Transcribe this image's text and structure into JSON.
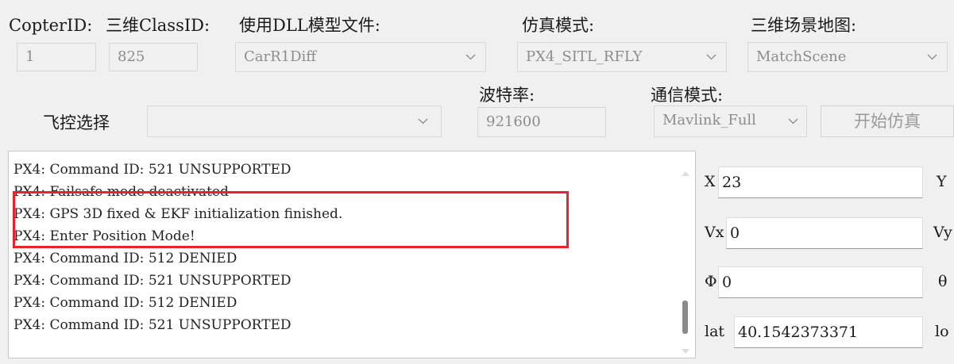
{
  "header": {
    "copter_id_label": "CopterID:",
    "class_id_label": "三维ClassID:",
    "dll_label": "使用DLL模型文件:",
    "sim_mode_label": "仿真模式:",
    "scene_label": "三维场景地图:"
  },
  "fields": {
    "copter_id_value": "1",
    "class_id_value": "825",
    "dll_value": "CarR1Diff",
    "sim_mode_value": "PX4_SITL_RFLY",
    "scene_value": "MatchScene"
  },
  "row2": {
    "fc_label": "飞控选择",
    "fc_value": "",
    "baud_label": "波特率:",
    "baud_value": "921600",
    "comm_label": "通信模式:",
    "comm_value": "Mavlink_Full",
    "start_button": "开始仿真"
  },
  "log": {
    "lines": [
      "PX4: Command ID: 521 UNSUPPORTED",
      "PX4: Failsafe mode deactivated",
      "PX4: GPS 3D fixed & EKF initialization finished.",
      "PX4: Enter Position Mode!",
      "PX4: Command ID: 512 DENIED",
      "PX4: Command ID: 521 UNSUPPORTED",
      "PX4: Command ID: 512 DENIED",
      "PX4: Command ID: 521 UNSUPPORTED"
    ],
    "highlight_color": "#e8242a"
  },
  "state": {
    "x_label": "X",
    "x_value": "23",
    "y_label": "Y",
    "vx_label": "Vx",
    "vx_value": "0",
    "vy_label": "Vy",
    "phi_label": "Φ",
    "phi_value": "0",
    "theta_label": "θ",
    "lat_label": "lat",
    "lat_value": "40.1542373371",
    "lon_label": "lo"
  },
  "icons": {
    "dropdown": "chevron-down-icon"
  }
}
